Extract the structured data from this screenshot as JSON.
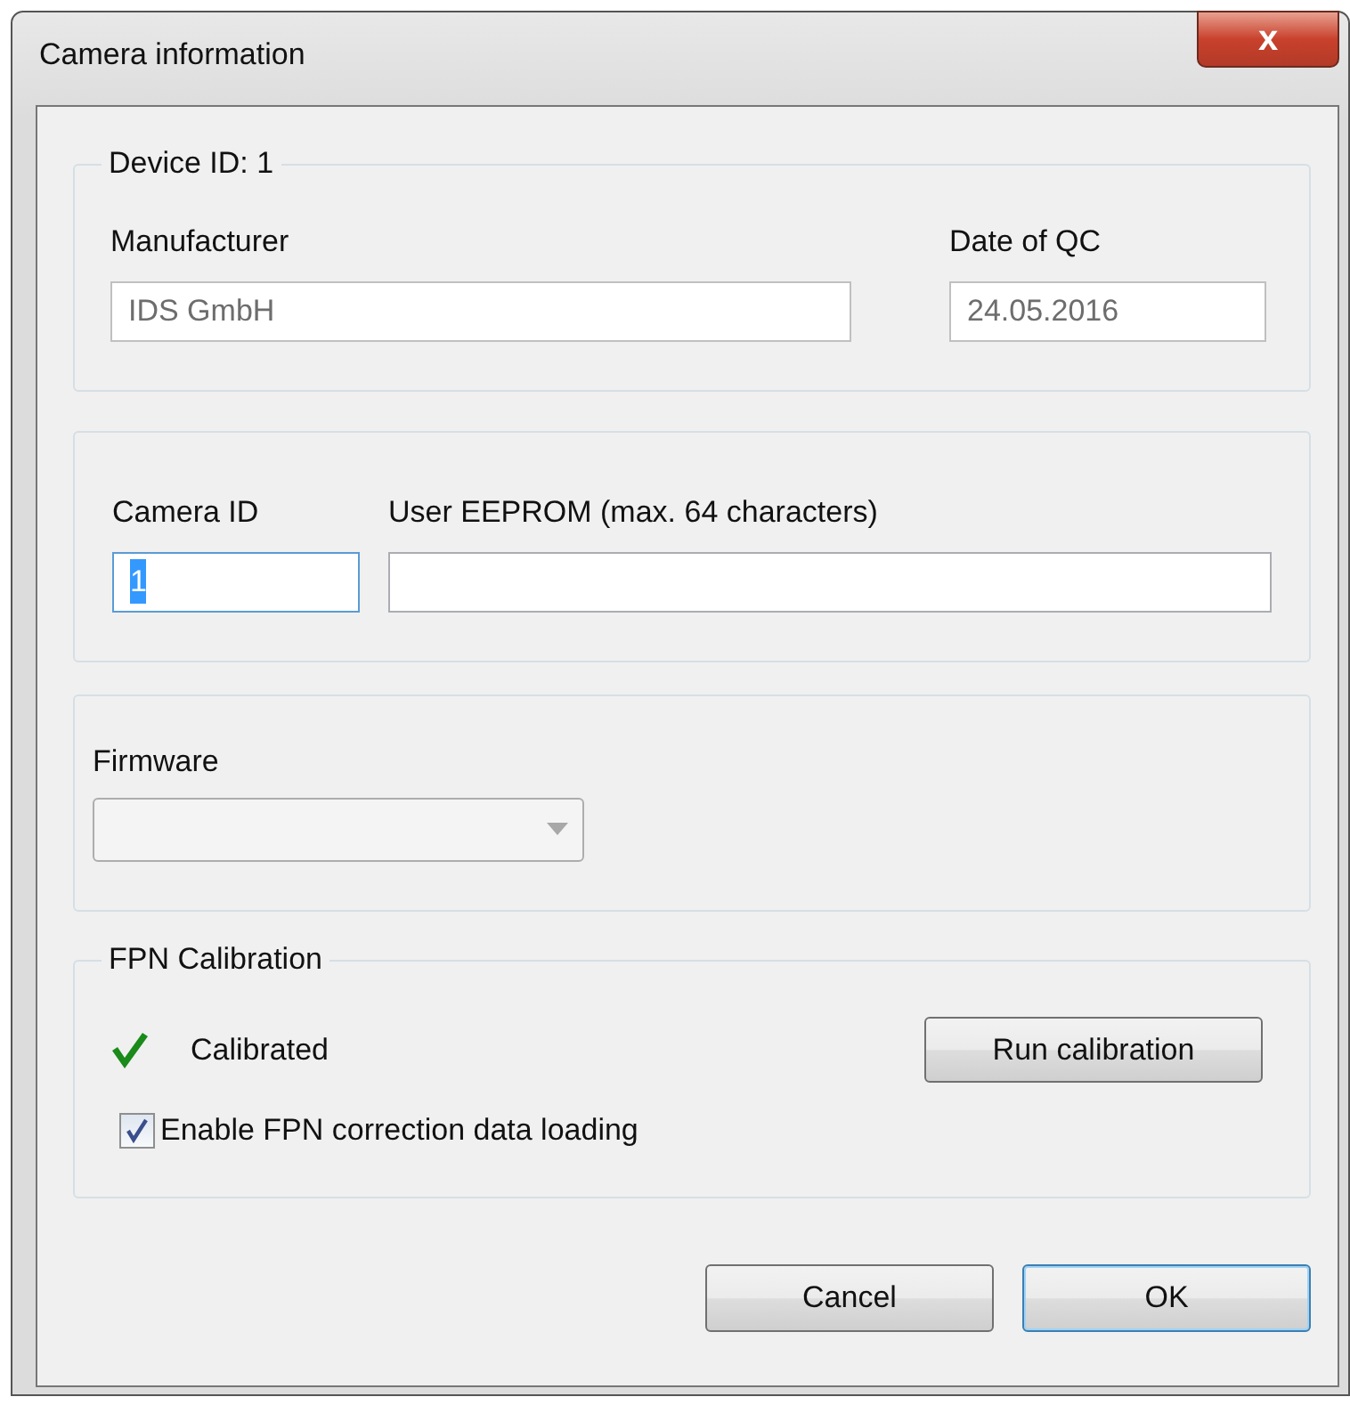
{
  "window": {
    "title": "Camera information",
    "close_label": "x"
  },
  "device_group": {
    "legend": "Device ID: 1",
    "fields": [
      {
        "label": "Manufacturer",
        "value": "IDS GmbH",
        "disabled": true
      },
      {
        "label": "Date of QC",
        "value": "24.05.2016",
        "disabled": true
      }
    ]
  },
  "eeprom_group": {
    "fields": [
      {
        "label": "Camera ID",
        "value": "1",
        "focused": true,
        "disabled": false
      },
      {
        "label": "User EEPROM (max. 64 characters)",
        "focused": false,
        "disabled": false
      }
    ]
  },
  "firmware_group": {
    "label": "Firmware",
    "dropdown": {
      "disabled": true
    }
  },
  "fpn_group": {
    "legend": "FPN Calibration",
    "calibrated": true,
    "status": "Calibrated",
    "button": "Run calibration",
    "checkbox": {
      "label": "Enable FPN correction data loading",
      "checked": true
    }
  },
  "buttons": [
    {
      "label": "Cancel",
      "default": false
    },
    {
      "label": "OK",
      "default": true
    }
  ]
}
